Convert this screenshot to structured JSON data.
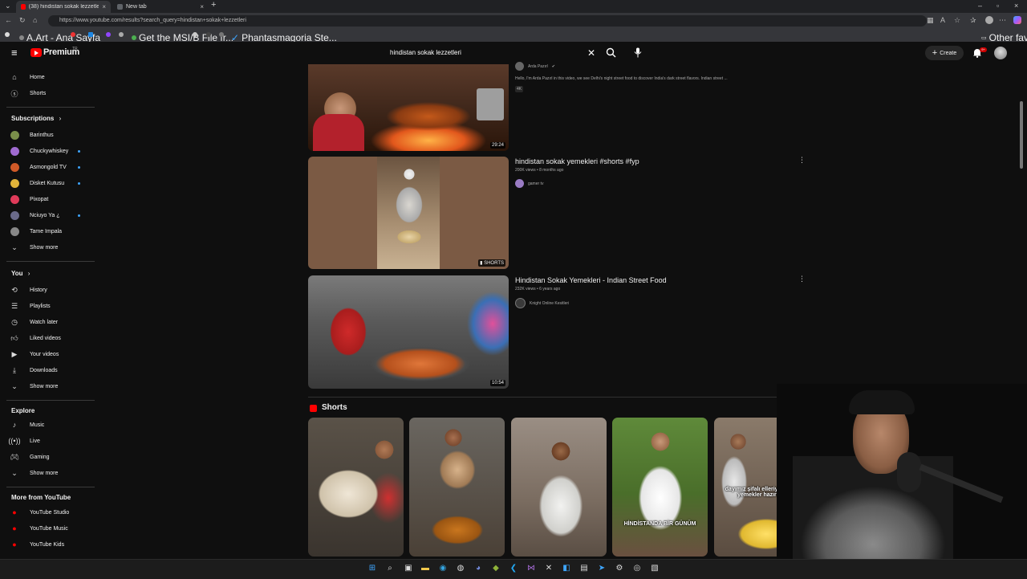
{
  "browser": {
    "tabs": [
      {
        "label": "(38) hindistan sokak lezzetleri - Yo",
        "active": true
      },
      {
        "label": "New tab",
        "active": false
      }
    ],
    "url": "https://www.youtube.com/results?search_query=hindistan+sokak+lezzetleri",
    "bookmarks": [
      "A.Art - Ana Sayfa",
      "Get the MSI/B File fr...",
      "Phantasmagoria Ste..."
    ],
    "other_favorites": "Other favorites"
  },
  "masthead": {
    "logo_text": "Premium",
    "logo_super": "TR",
    "search_value": "hindistan sokak lezzetleri",
    "create_label": "Create",
    "notifications_badge": "9+"
  },
  "sidebar": {
    "main": [
      {
        "label": "Home",
        "icon": "home-icon"
      },
      {
        "label": "Shorts",
        "icon": "shorts-icon"
      }
    ],
    "subscriptions_heading": "Subscriptions",
    "subscriptions": [
      {
        "label": "Barinthus",
        "live": false,
        "color": "#7a8f4a"
      },
      {
        "label": "Chuckywhiskey",
        "live": true,
        "color": "#a06bd1"
      },
      {
        "label": "Asmongold TV",
        "live": true,
        "color": "#d05a28"
      },
      {
        "label": "Disket Kutusu",
        "live": true,
        "color": "#e0b33a"
      },
      {
        "label": "Pixopat",
        "live": false,
        "color": "#e03b5a"
      },
      {
        "label": "Nciuyo Ya ¿",
        "live": true,
        "color": "#6a6a8a"
      },
      {
        "label": "Tame Impala",
        "live": false,
        "color": "#888888"
      }
    ],
    "show_more_1": "Show more",
    "you_heading": "You",
    "you": [
      {
        "label": "History",
        "icon": "history-icon"
      },
      {
        "label": "Playlists",
        "icon": "playlists-icon"
      },
      {
        "label": "Watch later",
        "icon": "watch-later-icon"
      },
      {
        "label": "Liked videos",
        "icon": "thumbs-up-icon"
      },
      {
        "label": "Your videos",
        "icon": "your-videos-icon"
      },
      {
        "label": "Downloads",
        "icon": "download-icon"
      }
    ],
    "show_more_2": "Show more",
    "explore_heading": "Explore",
    "explore": [
      {
        "label": "Music",
        "icon": "music-icon"
      },
      {
        "label": "Live",
        "icon": "live-icon"
      },
      {
        "label": "Gaming",
        "icon": "gaming-icon"
      }
    ],
    "show_more_3": "Show more",
    "more_heading": "More from YouTube",
    "more": [
      {
        "label": "YouTube Studio"
      },
      {
        "label": "YouTube Music"
      },
      {
        "label": "YouTube Kids"
      }
    ]
  },
  "results": [
    {
      "channel": "Arda Pazırl",
      "verified": true,
      "snippet": "Hello, I'm Arda Pazırl in this video, we see Delhi's night street food to discover India's dark street flavors. Indian street ...",
      "badge": "4K",
      "duration": "29:24"
    },
    {
      "title": "hindistan sokak yemekleri #shorts #fyp",
      "meta": "200K views • 8 months ago",
      "channel": "gamer tv",
      "duration": "SHORTS"
    },
    {
      "title": "Hindistan Sokak Yemekleri - Indian Street Food",
      "meta": "232K views • 6 years ago",
      "channel": "Knight Online Kesitleri",
      "duration": "10:54"
    }
  ],
  "shorts": {
    "heading": "Shorts",
    "items": [
      {
        "caption": ""
      },
      {
        "caption": ""
      },
      {
        "caption": ""
      },
      {
        "caption": "HİNDİSTANDA BİR GÜNÜM"
      },
      {
        "caption": "dayımız şifalı elleriyle güzel yemekler hazırlıyo"
      }
    ]
  }
}
